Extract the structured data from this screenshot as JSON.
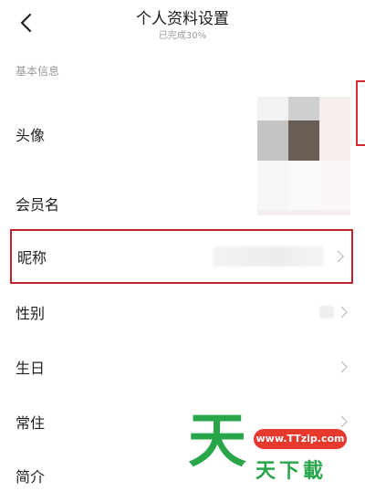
{
  "header": {
    "title": "个人资料设置",
    "subtitle": "已完成30%"
  },
  "section": {
    "label": "基本信息"
  },
  "rows": [
    {
      "label": "头像",
      "value": ""
    },
    {
      "label": "会员名",
      "value": ""
    },
    {
      "label": "昵称",
      "value": ""
    },
    {
      "label": "性别",
      "value": ""
    },
    {
      "label": "生日",
      "value": ""
    },
    {
      "label": "常住",
      "value": ""
    },
    {
      "label": "简介",
      "value": ""
    }
  ],
  "icons": {
    "back": "back-arrow-icon",
    "chevron": "chevron-right-icon"
  },
  "colors": {
    "highlight_border": "#c0222d",
    "watermark_green": "#2aa64a",
    "watermark_red": "#e8392f"
  },
  "watermark": {
    "big": "天",
    "url": "www.TTzip.com",
    "text": "天下載"
  }
}
